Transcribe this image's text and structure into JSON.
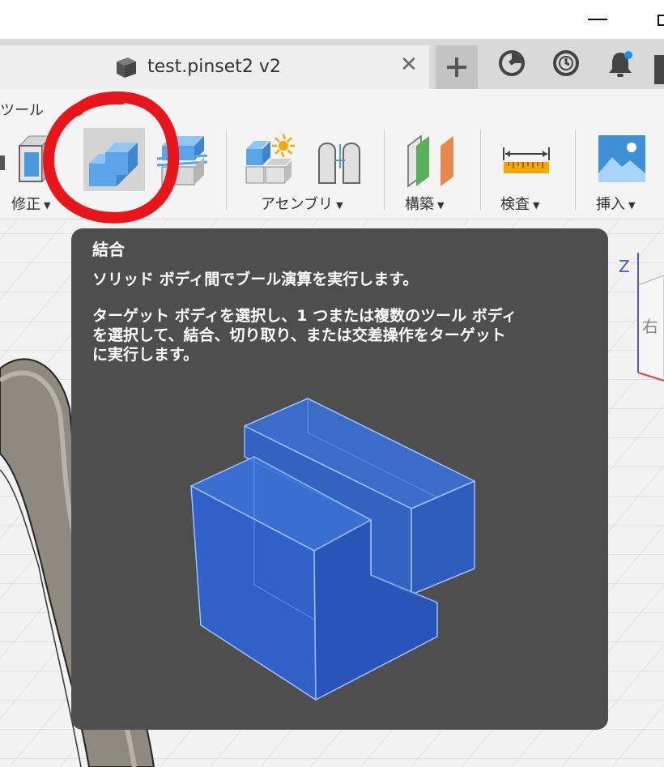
{
  "window": {
    "minimize_icon": "minimize-icon",
    "maximize_icon": "maximize-icon"
  },
  "document_tab": {
    "title": "test.pinset2 v2",
    "close_glyph": "✕"
  },
  "tabbar_icons": [
    "new-tab-icon",
    "job-status-icon",
    "history-clock-icon",
    "notifications-bell-icon"
  ],
  "toolbar": {
    "active_tab_label": "ツール",
    "groups": [
      {
        "label": "修正"
      },
      {
        "label": "アセンブリ"
      },
      {
        "label": "構築"
      },
      {
        "label": "検査"
      },
      {
        "label": "挿入"
      }
    ]
  },
  "tooltip": {
    "title": "結合",
    "description": "ソリッド ボディ間でブール演算を実行します。",
    "detail": "ターゲット ボディを選択し、1 つまたは複数のツール ボディを選択して、結合、切り取り、またはターゲットに実行します。",
    "detail_lines": [
      "ターゲット ボディを選択し、1 つまたは複数のツール ボディ",
      "を選択して、結合、切り取り、または交差操作をターゲット",
      "に実行します。"
    ]
  },
  "viewcube": {
    "axis_label": "Z",
    "face_label": "右"
  },
  "colors": {
    "annotation_red": "#e8161b",
    "tooltip_bg": "#4e4e4e",
    "solid_blue": "#2f6fd8",
    "tool_blue": "#5aa5e8"
  }
}
